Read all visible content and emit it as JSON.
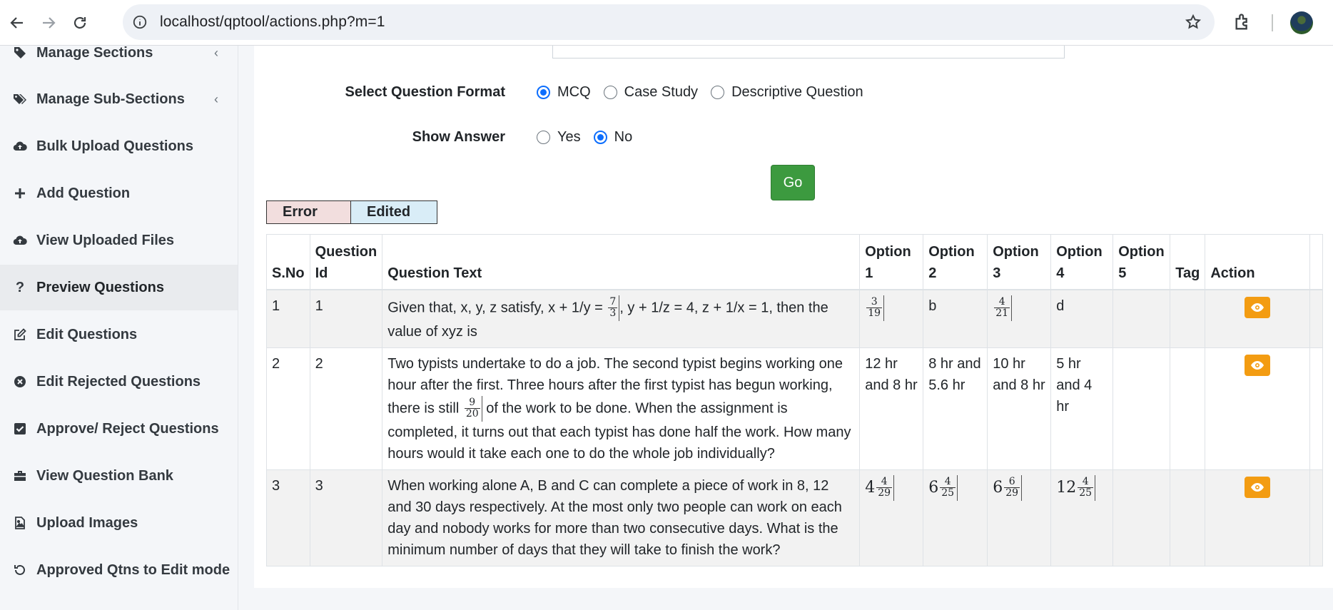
{
  "browser": {
    "url": "localhost/qptool/actions.php?m=1"
  },
  "sidebar": {
    "items": [
      {
        "label": "Manage Sections",
        "icon": "tag-icon",
        "chevron": "‹"
      },
      {
        "label": "Manage Sub-Sections",
        "icon": "tags-icon",
        "chevron": "‹"
      },
      {
        "label": "Bulk Upload Questions",
        "icon": "cloud-upload-icon"
      },
      {
        "label": "Add Question",
        "icon": "plus-icon"
      },
      {
        "label": "View Uploaded Files",
        "icon": "cloud-upload-icon"
      },
      {
        "label": "Preview Questions",
        "icon": "question-icon",
        "active": true
      },
      {
        "label": "Edit Questions",
        "icon": "edit-icon"
      },
      {
        "label": "Edit Rejected Questions",
        "icon": "times-circle-icon"
      },
      {
        "label": "Approve/ Reject Questions",
        "icon": "check-square-icon"
      },
      {
        "label": "View Question Bank",
        "icon": "briefcase-icon"
      },
      {
        "label": "Upload Images",
        "icon": "image-file-icon"
      },
      {
        "label": "Approved Qtns to Edit mode",
        "icon": "undo-icon"
      }
    ]
  },
  "form": {
    "format_label": "Select Question Format",
    "format_options": [
      "MCQ",
      "Case Study",
      "Descriptive Question"
    ],
    "format_selected": "MCQ",
    "answer_label": "Show Answer",
    "answer_options": [
      "Yes",
      "No"
    ],
    "answer_selected": "No",
    "go_label": "Go"
  },
  "legend": {
    "error": "Error",
    "edited": "Edited"
  },
  "table": {
    "headers": {
      "sno": "S.No",
      "qid_1": "Question",
      "qid_2": "Id",
      "qtext": "Question Text",
      "opt1_1": "Option",
      "opt1_2": "1",
      "opt2_1": "Option",
      "opt2_2": "2",
      "opt3_1": "Option",
      "opt3_2": "3",
      "opt4_1": "Option",
      "opt4_2": "4",
      "opt5_1": "Option",
      "opt5_2": "5",
      "tag": "Tag",
      "action": "Action"
    },
    "rows": [
      {
        "sno": "1",
        "qid": "1",
        "text_a": "Given that, x, y, z satisfy, x + 1/y =",
        "text_frac_n": "7",
        "text_frac_d": "3",
        "text_b": ", y + 1/z = 4, z + 1/x = 1, then the value of xyz is",
        "opt1_n": "3",
        "opt1_d": "19",
        "opt2": "b",
        "opt3_n": "4",
        "opt3_d": "21",
        "opt4": "d"
      },
      {
        "sno": "2",
        "qid": "2",
        "text_a": "Two typists undertake to do a job. The second typist begins working one hour after the first. Three hours after the first typist has begun working, there is still",
        "text_frac_n": "9",
        "text_frac_d": "20",
        "text_b": "of the work to be done. When the assignment is completed, it turns out that each typist has done half the work. How many hours would it take each one to do the whole job individually?",
        "opt1": "12 hr and 8 hr",
        "opt2": "8 hr and 5.6 hr",
        "opt3": "10 hr and 8 hr",
        "opt4": "5 hr and 4 hr"
      },
      {
        "sno": "3",
        "qid": "3",
        "text": "When working alone A, B and C can complete a piece of work in 8, 12 and 30 days respectively. At the most only two people can work on each day and nobody works for more than two consecutive days. What is the minimum number of days that they will take to finish the work?",
        "opt1_w": "4",
        "opt1_n": "4",
        "opt1_d": "29",
        "opt2_w": "6",
        "opt2_n": "4",
        "opt2_d": "25",
        "opt3_w": "6",
        "opt3_n": "6",
        "opt3_d": "29",
        "opt4_w": "12",
        "opt4_n": "4",
        "opt4_d": "25"
      }
    ]
  },
  "colors": {
    "accent": "#0d6efd",
    "go_button": "#3c9a3f",
    "action_button": "#f39c12",
    "error_bg": "#f2dede",
    "edited_bg": "#d9edf7"
  }
}
